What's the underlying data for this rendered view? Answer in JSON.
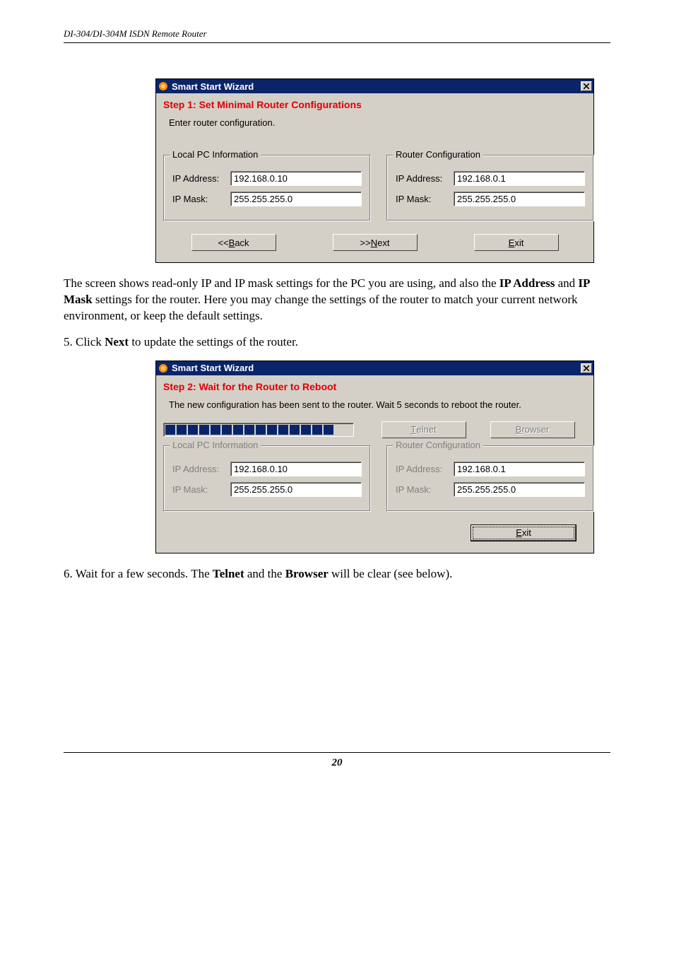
{
  "header": "DI-304/DI-304M ISDN Remote Router",
  "page_number": "20",
  "dialog1": {
    "title": "Smart Start Wizard",
    "step_title": "Step 1: Set Minimal Router Configurations",
    "instruction": "Enter router configuration.",
    "local_pc": {
      "legend": "Local PC Information",
      "ip_label": "IP Address:",
      "ip_value": "192.168.0.10",
      "mask_label": "IP Mask:",
      "mask_value": "255.255.255.0"
    },
    "router": {
      "legend": "Router Configuration",
      "ip_label": "IP Address:",
      "ip_value": "192.168.0.1",
      "mask_label": "IP Mask:",
      "mask_value": "255.255.255.0"
    },
    "buttons": {
      "back_prefix": "<<",
      "back_mn": "B",
      "back_suffix": "ack",
      "next_prefix": ">>",
      "next_mn": "N",
      "next_suffix": "ext",
      "exit_mn": "E",
      "exit_suffix": "xit"
    }
  },
  "para1_a": "The screen shows read-only IP and IP mask settings for the PC you are using, and also the ",
  "para1_b": "IP Address",
  "para1_c": " and ",
  "para1_d": "IP Mask",
  "para1_e": " settings for the router. Here you may change the settings of the router to match your current network environment, or keep the default settings.",
  "para2_a": "5. Click ",
  "para2_b": "Next",
  "para2_c": " to update the settings of the router.",
  "dialog2": {
    "title": "Smart Start Wizard",
    "step_title": "Step 2: Wait for the Router to Reboot",
    "instruction": "The new configuration has been sent to the router. Wait 5 seconds to reboot the router.",
    "local_pc": {
      "legend": "Local PC Information",
      "ip_label": "IP Address:",
      "ip_value": "192.168.0.10",
      "mask_label": "IP Mask:",
      "mask_value": "255.255.255.0"
    },
    "router": {
      "legend": "Router Configuration",
      "ip_label": "IP Address:",
      "ip_value": "192.168.0.1",
      "mask_label": "IP Mask:",
      "mask_value": "255.255.255.0"
    },
    "buttons": {
      "telnet_mn": "T",
      "telnet_suffix": "elnet",
      "browser_mn": "B",
      "browser_suffix": "rowser",
      "exit_mn": "E",
      "exit_suffix": "xit"
    }
  },
  "para3_a": "6. Wait for a few seconds. The ",
  "para3_b": "Telnet",
  "para3_c": " and the ",
  "para3_d": "Browser",
  "para3_e": " will be clear (see below)."
}
